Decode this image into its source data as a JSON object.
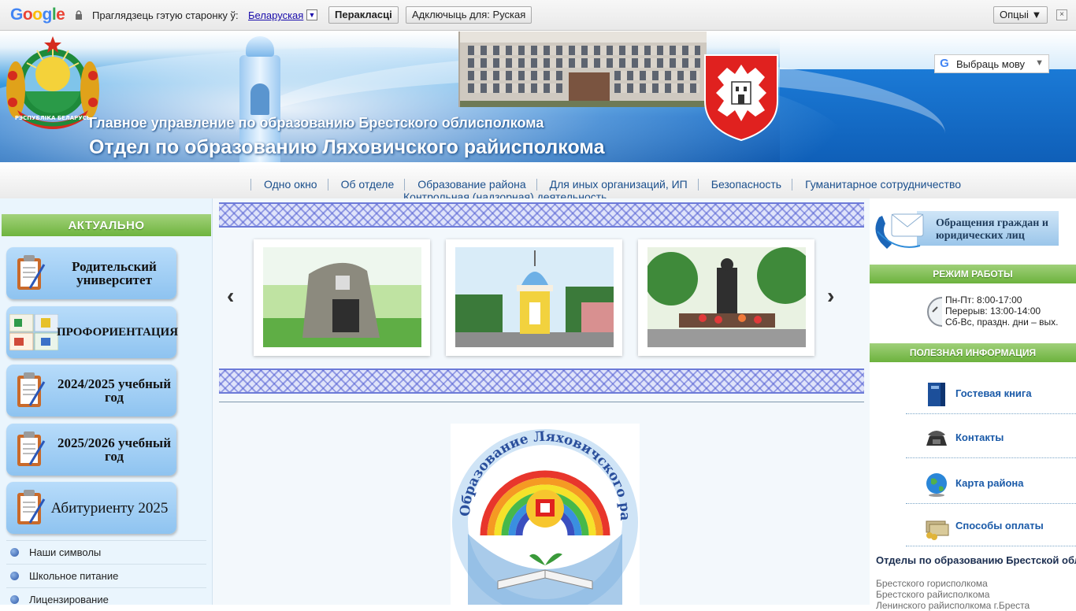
{
  "google_bar": {
    "logo_letters": [
      "G",
      "o",
      "o",
      "g",
      "l",
      "e"
    ],
    "prompt": "Праглядзець гэтую старонку ў:",
    "language": "Беларуская",
    "translate_button": "Перакласці",
    "disable_button": "Адключыць для: Руская",
    "options_button": "Опцыі ▼",
    "close_glyph": "×"
  },
  "header": {
    "title_line1": "Главное управление по образованию Брестского облисполкома",
    "title_line2": "Отдел по образованию Ляховичского райисполкома",
    "language_selector": "Выбраць мову",
    "emblem_text": "РЭСПУБЛІКА БЕЛАРУСЬ"
  },
  "nav": {
    "items": [
      "Одно окно",
      "Об отделе",
      "Образование района",
      "Для иных организаций, ИП",
      "Безопасность",
      "Гуманитарное сотрудничество",
      "Контрольная (надзорная) деятельность"
    ]
  },
  "left": {
    "section_title": "АКТУАЛЬНО",
    "buttons": [
      "Родительский университет",
      "ПРОФОРИЕНТАЦИЯ",
      "2024/2025 учебный год",
      "2025/2026 учебный год",
      "Абитуриенту 2025"
    ],
    "links": [
      "Наши символы",
      "Школьное питание",
      "Лицензирование"
    ]
  },
  "center": {
    "carousel_prev": "‹",
    "carousel_next": "›",
    "logo_text": "Образование Ляховичского района"
  },
  "right": {
    "appeals": "Обращения граждан и юридических лиц",
    "work_hours_title": "РЕЖИМ РАБОТЫ",
    "work_hours": [
      "Пн-Пт: 8:00-17:00",
      "Перерыв: 13:00-14:00",
      "Сб-Вс, праздн. дни – вых."
    ],
    "useful_title": "ПОЛЕЗНАЯ ИНФОРМАЦИЯ",
    "useful_items": [
      "Гостевая книга",
      "Контакты",
      "Карта района",
      "Способы оплаты"
    ],
    "departments_title": "Отделы по образованию Брестской области",
    "departments": [
      "Брестского горисполкома",
      "Брестского райисполкома",
      "Ленинского райисполкома г.Бреста"
    ]
  },
  "colors": {
    "accent_green": "#6eb43e",
    "link_blue": "#1a5aa8",
    "banner_blue": "#1368c4"
  }
}
